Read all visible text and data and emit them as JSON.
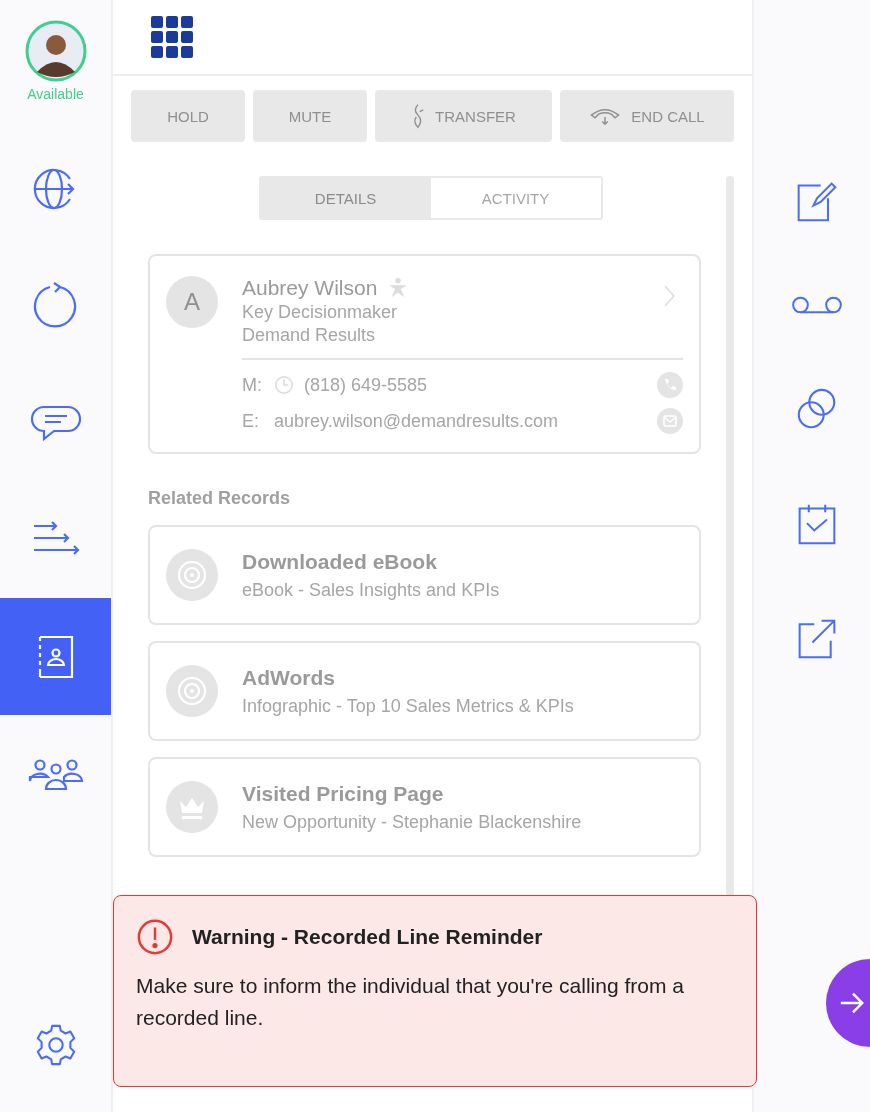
{
  "agent": {
    "status": "Available"
  },
  "sidebar": {
    "items": [
      {
        "selected": false
      },
      {
        "selected": false
      },
      {
        "selected": false
      },
      {
        "selected": false
      },
      {
        "selected": true
      },
      {
        "selected": false
      }
    ]
  },
  "call_buttons": [
    {
      "label": "HOLD",
      "kind": "plain"
    },
    {
      "label": "MUTE",
      "kind": "plain"
    },
    {
      "label": "TRANSFER",
      "kind": "transfer"
    },
    {
      "label": "END CALL",
      "kind": "end"
    }
  ],
  "tabs": [
    {
      "label": "DETAILS",
      "selected": true
    },
    {
      "label": "ACTIVITY",
      "selected": false
    }
  ],
  "contact": {
    "initial": "A",
    "name": "Aubrey Wilson",
    "title": "Key Decisionmaker",
    "company": "Demand Results",
    "phone_label": "M:",
    "phone": "(818) 649-5585",
    "email_label": "E:",
    "email": "aubrey.wilson@demandresults.com"
  },
  "related_records": {
    "heading": "Related Records",
    "items": [
      {
        "kind": "target",
        "title": "Downloaded eBook",
        "subtitle": "eBook - Sales Insights and KPIs"
      },
      {
        "kind": "target",
        "title": "AdWords",
        "subtitle": "Infographic - Top 10 Sales Metrics & KPIs"
      },
      {
        "kind": "crown",
        "title": "Visited Pricing Page",
        "subtitle": "New Opportunity - Stephanie Blackenshire"
      }
    ]
  },
  "warning": {
    "title": "Warning - Recorded Line Reminder",
    "message": "Make sure to inform the individual that you're calling from a recorded line."
  }
}
